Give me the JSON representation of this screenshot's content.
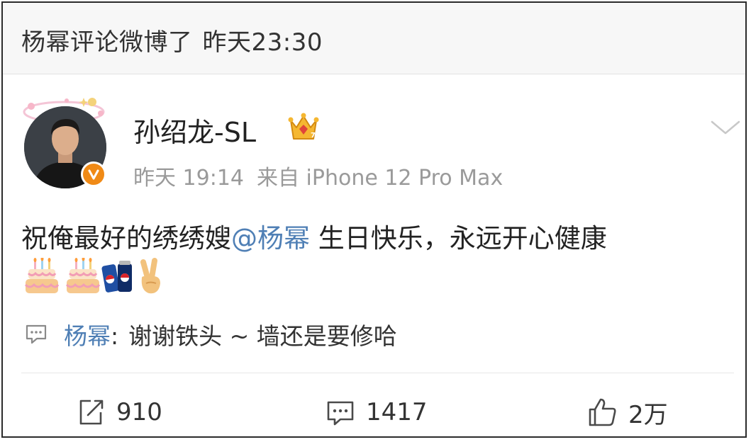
{
  "header": {
    "title": "杨幂评论微博了",
    "time": "昨天23:30"
  },
  "post": {
    "author": "孙绍龙-SL",
    "time": "昨天 19:14",
    "source": "来自 iPhone 12 Pro Max",
    "content_before": "祝俺最好的绣绣嫂",
    "mention": "@杨幂",
    "content_after": " 生日快乐，永远开心健康",
    "emojis": [
      "cake-emoji",
      "cake-emoji",
      "pepsi-cans-emoji",
      "victory-hand-emoji"
    ]
  },
  "comment": {
    "author": "杨幂",
    "separator": ":",
    "text": "谢谢铁头 ~ 墙还是要修哈"
  },
  "actions": {
    "repost_count": "910",
    "comment_count": "1417",
    "like_count": "2万"
  },
  "colors": {
    "link": "#4f7fb5",
    "verified": "#f08a16",
    "meta": "#9a9a9a"
  }
}
